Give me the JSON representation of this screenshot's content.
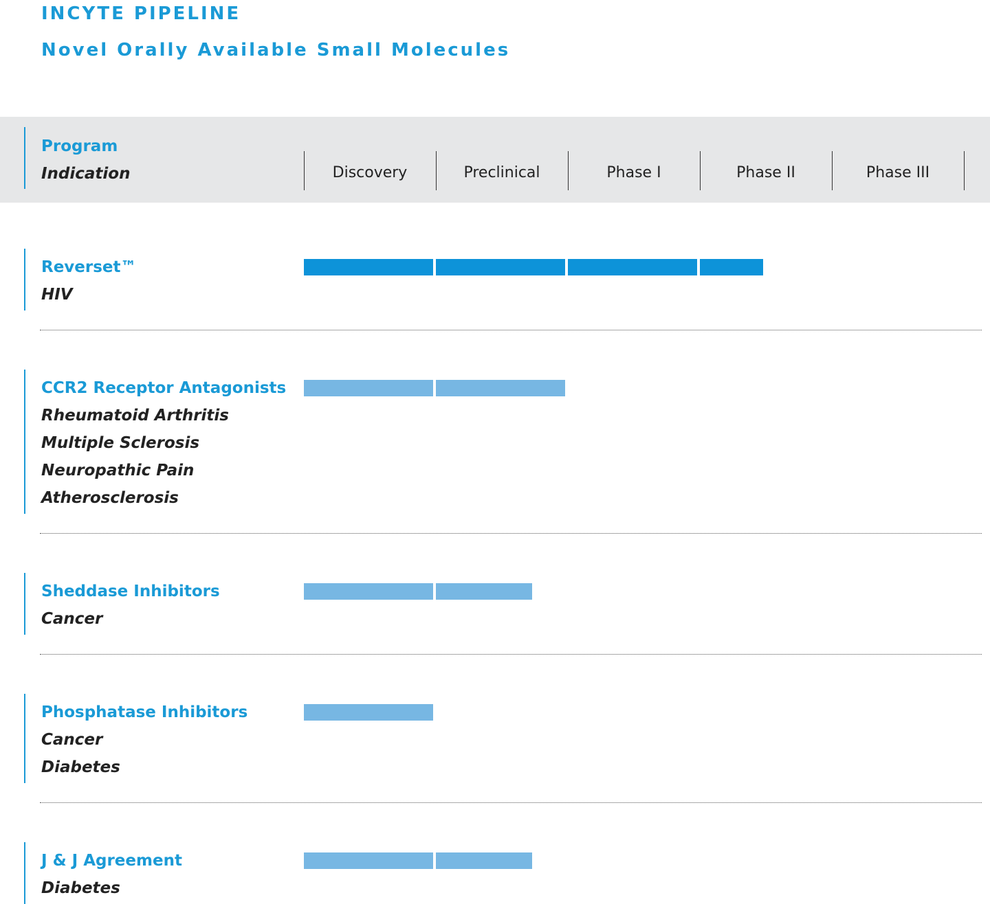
{
  "title": "INCYTE PIPELINE",
  "subtitle": "Novel Orally Available Small Molecules",
  "header": {
    "program_label": "Program",
    "indication_label": "Indication"
  },
  "colors": {
    "accent": "#1a9ad6",
    "bar_dark": "#0d93d9",
    "bar_light": "#77b7e3",
    "header_bg": "#e6e7e8"
  },
  "chart_data": {
    "type": "bar",
    "orientation": "horizontal",
    "stacked": true,
    "phases": [
      "Discovery",
      "Preclinical",
      "Phase I",
      "Phase II",
      "Phase III"
    ],
    "programs": [
      {
        "name": "Reverset™",
        "indications": [
          "HIV"
        ],
        "progress_phases": 3.5,
        "shade": "dark"
      },
      {
        "name": "CCR2 Receptor Antagonists",
        "indications": [
          "Rheumatoid Arthritis",
          "Multiple Sclerosis",
          "Neuropathic Pain",
          "Atherosclerosis"
        ],
        "progress_phases": 2.0,
        "shade": "light"
      },
      {
        "name": "Sheddase Inhibitors",
        "indications": [
          "Cancer"
        ],
        "progress_phases": 1.75,
        "shade": "light"
      },
      {
        "name": "Phosphatase Inhibitors",
        "indications": [
          "Cancer",
          "Diabetes"
        ],
        "progress_phases": 1.0,
        "shade": "light"
      },
      {
        "name": "J & J Agreement",
        "indications": [
          "Diabetes"
        ],
        "progress_phases": 1.75,
        "shade": "light"
      }
    ]
  }
}
